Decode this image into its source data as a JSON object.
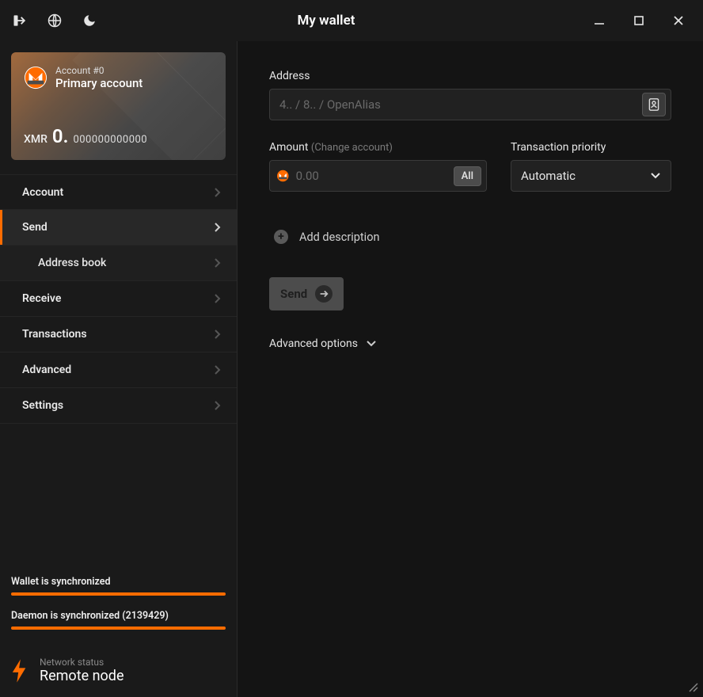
{
  "title": "My wallet",
  "account": {
    "sub": "Account #0",
    "name": "Primary account",
    "currency": "XMR",
    "balance_int": "0.",
    "balance_frac": "000000000000"
  },
  "nav": {
    "account": "Account",
    "send": "Send",
    "address_book": "Address book",
    "receive": "Receive",
    "transactions": "Transactions",
    "advanced": "Advanced",
    "settings": "Settings"
  },
  "sync": {
    "wallet": "Wallet is synchronized",
    "daemon": "Daemon is synchronized (2139429)"
  },
  "network": {
    "label": "Network status",
    "value": "Remote node"
  },
  "form": {
    "address_label": "Address",
    "address_placeholder": "4.. / 8.. / OpenAlias",
    "amount_label": "Amount",
    "amount_hint": "(Change account)",
    "amount_placeholder": "0.00",
    "all": "All",
    "priority_label": "Transaction priority",
    "priority_value": "Automatic",
    "add_description": "Add description",
    "send": "Send",
    "advanced_options": "Advanced options"
  }
}
